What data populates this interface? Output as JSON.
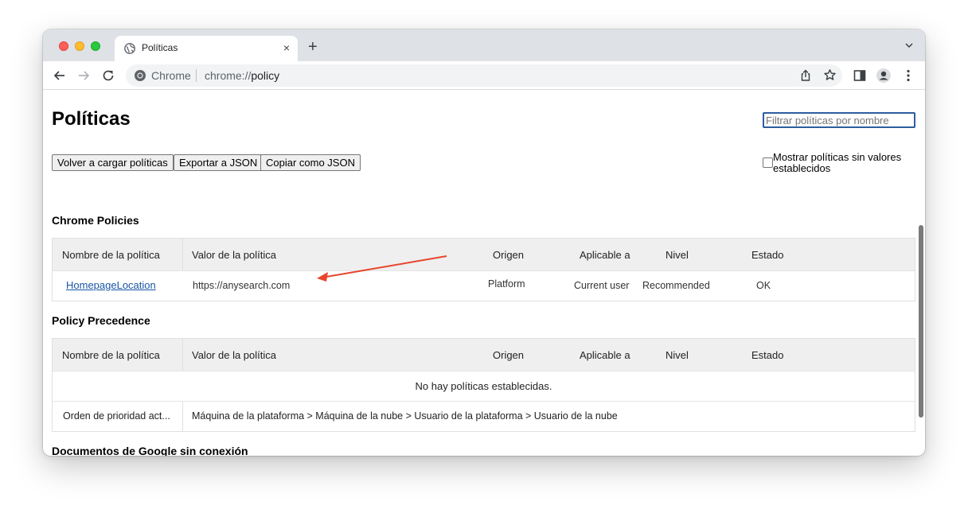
{
  "browser": {
    "tab_title": "Políticas",
    "tab_close": "×",
    "new_tab": "+",
    "omnibox_brand": "Chrome",
    "url_scheme": "chrome://",
    "url_host": "policy"
  },
  "page": {
    "title": "Políticas",
    "filter_placeholder": "Filtrar políticas por nombre",
    "buttons": {
      "reload": "Volver a cargar políticas",
      "export": "Exportar a JSON",
      "copy": "Copiar como JSON"
    },
    "show_unset_label": "Mostrar políticas sin valores establecidos"
  },
  "columns": [
    "Nombre de la política",
    "Valor de la política",
    "Origen",
    "Aplicable a",
    "Nivel",
    "Estado"
  ],
  "chrome_policies": {
    "title": "Chrome Policies",
    "rows": [
      {
        "name": "HomepageLocation",
        "value": "https://anysearch.com",
        "source": "Platform",
        "scope": "Current user",
        "level": "Recommended",
        "status": "OK"
      }
    ]
  },
  "policy_precedence": {
    "title": "Policy Precedence",
    "empty_message": "No hay políticas establecidas.",
    "order_label": "Orden de prioridad act...",
    "order_value": "Máquina de la plataforma > Máquina de la nube > Usuario de la plataforma > Usuario de la nube"
  },
  "offline_docs": {
    "title": "Documentos de Google sin conexión"
  },
  "colors": {
    "link": "#1a55a5",
    "annotation_arrow": "#e8452c",
    "filter_border": "#2e5d9e"
  }
}
